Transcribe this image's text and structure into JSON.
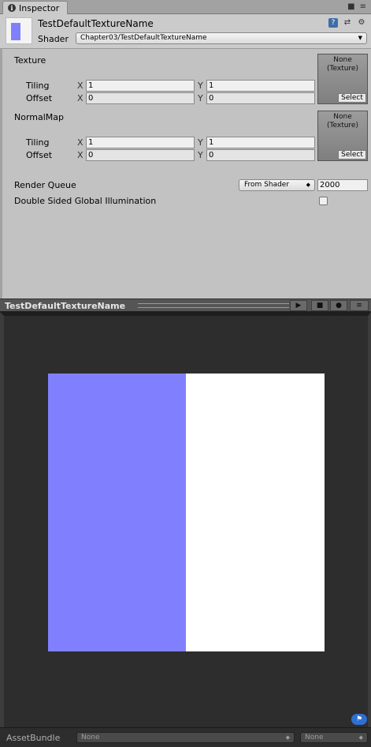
{
  "tab": {
    "label": "Inspector"
  },
  "material": {
    "name": "TestDefaultTextureName"
  },
  "shader": {
    "label": "Shader",
    "value": "Chapter03/TestDefaultTextureName"
  },
  "properties": {
    "texture": {
      "label": "Texture",
      "tiling_label": "Tiling",
      "offset_label": "Offset",
      "tiling_x": "1",
      "tiling_y": "1",
      "offset_x": "0",
      "offset_y": "0",
      "slot_none": "None",
      "slot_type": "(Texture)",
      "select_label": "Select"
    },
    "normalmap": {
      "label": "NormalMap",
      "tiling_label": "Tiling",
      "offset_label": "Offset",
      "tiling_x": "1",
      "tiling_y": "1",
      "offset_x": "0",
      "offset_y": "0",
      "slot_none": "None",
      "slot_type": "(Texture)",
      "select_label": "Select"
    },
    "axis_x": "X",
    "axis_y": "Y",
    "render_queue": {
      "label": "Render Queue",
      "mode": "From Shader",
      "value": "2000"
    },
    "double_sided": {
      "label": "Double Sided Global Illumination",
      "checked": false
    }
  },
  "preview": {
    "title": "TestDefaultTextureName",
    "colors": {
      "left": "#8080ff",
      "right": "#ffffff",
      "background": "#2d2d2d"
    }
  },
  "asset_bundle": {
    "label": "AssetBundle",
    "name": "None",
    "variant": "None"
  }
}
